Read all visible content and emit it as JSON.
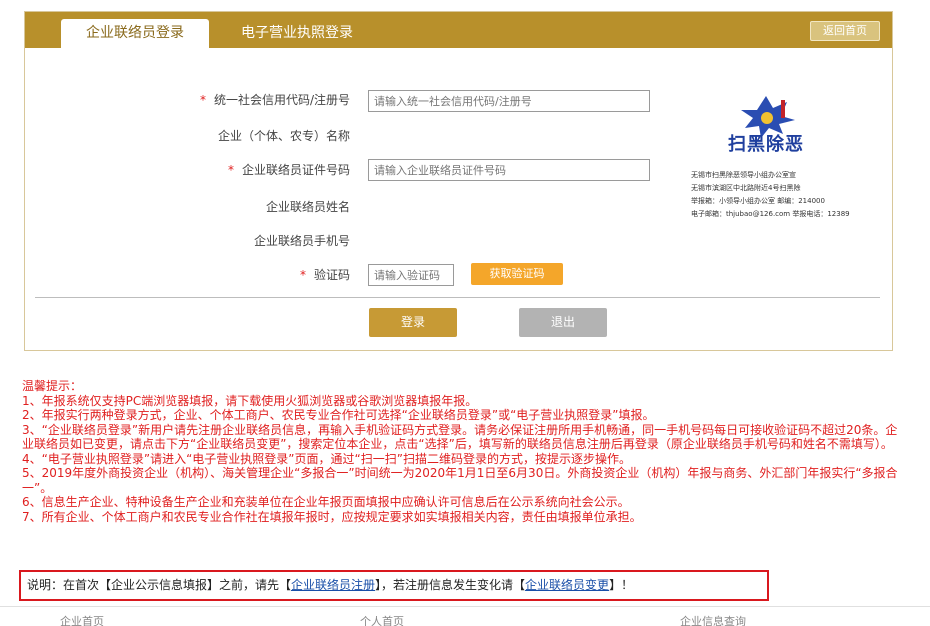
{
  "tabs": {
    "active": "企业联络员登录",
    "inactive": "电子营业执照登录",
    "home": "返回首页"
  },
  "form": {
    "credit_code": {
      "label": "统一社会信用代码/注册号",
      "placeholder": "请输入统一社会信用代码/注册号"
    },
    "company_name": {
      "label": "企业（个体、农专）名称"
    },
    "contact_id": {
      "label": "企业联络员证件号码",
      "placeholder": "请输入企业联络员证件号码"
    },
    "contact_name": {
      "label": "企业联络员姓名"
    },
    "contact_phone": {
      "label": "企业联络员手机号"
    },
    "captcha": {
      "label": "验证码",
      "placeholder": "请输入验证码",
      "button": "获取验证码"
    },
    "required_mark": "*",
    "login_button": "登录",
    "exit_button": "退出"
  },
  "badge": {
    "title": "扫黑除恶",
    "lines": [
      "无锡市扫黑除恶领导小组办公室宣",
      "无锡市滨湖区中北路附近4号扫黑除",
      "举报箱：小领导小组办公室  邮编：214000",
      "电子邮箱：thjubao@126.com  举报电话：12389"
    ]
  },
  "notice": {
    "title": "温馨提示：",
    "items": [
      "1、年报系统仅支持PC端浏览器填报，请下载使用火狐浏览器或谷歌浏览器填报年报。",
      "2、年报实行两种登录方式，企业、个体工商户、农民专业合作社可选择“企业联络员登录”或“电子营业执照登录”填报。",
      "3、“企业联络员登录”新用户请先注册企业联络员信息，再输入手机验证码方式登录。请务必保证注册所用手机畅通，同一手机号码每日可接收验证码不超过20条。企业联络员如已变更，请点击下方“企业联络员变更”，搜索定位本企业，点击“选择”后，填写新的联络员信息注册后再登录（原企业联络员手机号码和姓名不需填写）。",
      "4、“电子营业执照登录”请进入“电子营业执照登录”页面，通过“扫一扫”扫描二维码登录的方式，按提示逐步操作。",
      "5、2019年度外商投资企业（机构）、海关管理企业“多报合一”时间统一为2020年1月1日至6月30日。外商投资企业（机构）年报与商务、外汇部门年报实行“多报合一”。",
      "6、信息生产企业、特种设备生产企业和充装单位在企业年报页面填报中应确认许可信息后在公示系统向社会公示。",
      "7、所有企业、个体工商户和农民专业合作社在填报年报时，应按规定要求如实填报相关内容，责任由填报单位承担。"
    ]
  },
  "explain": {
    "prefix": "说明：在首次【企业公示信息填报】之前，请先【",
    "link1": "企业联络员注册",
    "middle": "】，若注册信息发生变化请【",
    "link2": "企业联络员变更",
    "suffix": "】！"
  },
  "footer": {
    "items": [
      "企业首页",
      "个人首页",
      "企业信息查询"
    ]
  }
}
